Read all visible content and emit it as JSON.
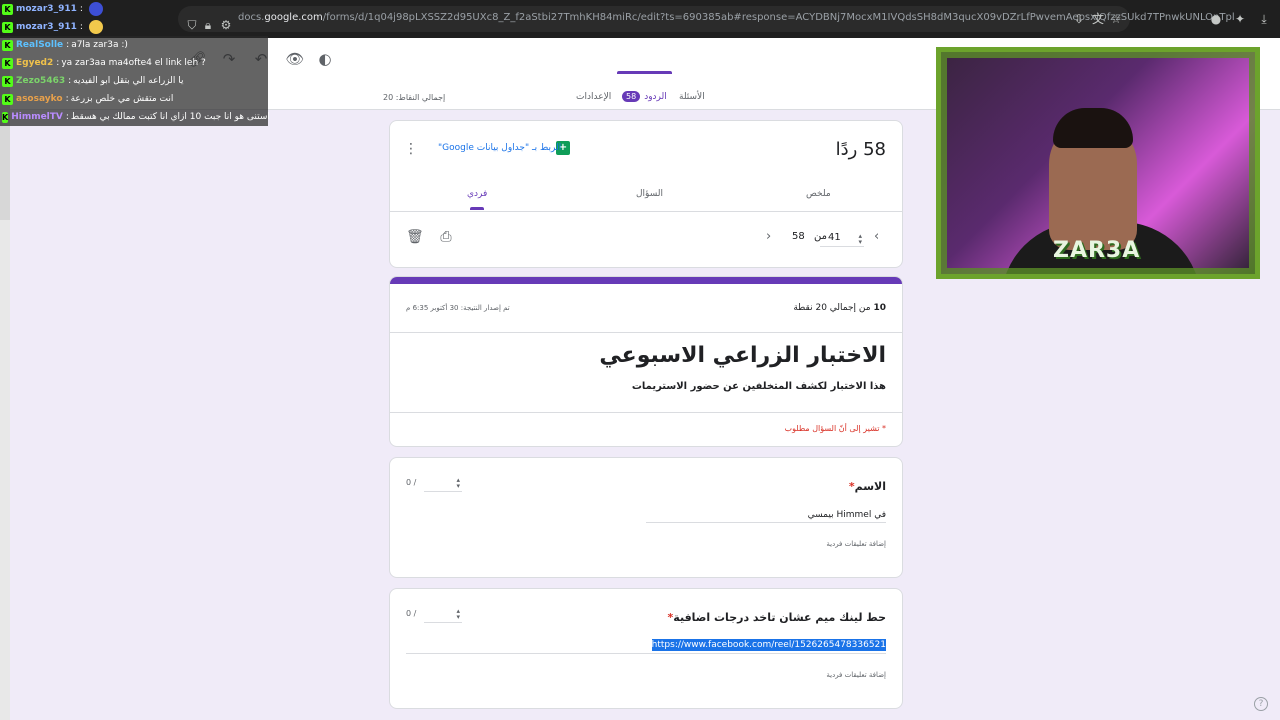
{
  "browser": {
    "url_prefix": "docs.",
    "url_domain": "google.com",
    "url_path": "/forms/d/1q04j98pLXSSZ2d95UXc8_Z_f2aStbi27TmhKH84miRc/edit?ts=690385ab#response=ACYDBNj7MocxM1IVQdsSH8dM3qucX09vDZrLfPwvemAepsxiQfzzSUkd7TPnwkUNLOnTpl"
  },
  "chat": [
    {
      "user": "mozar3_911",
      "msg": "",
      "color": "#8fb3ff"
    },
    {
      "user": "mozar3_911",
      "msg": "",
      "color": "#8fb3ff"
    },
    {
      "user": "RealSolle",
      "msg": "a7la zar3a :)",
      "color": "#5dc1ff"
    },
    {
      "user": "Egyed2",
      "msg": "ya zar3aa ma4ofte4 el link leh ?",
      "color": "#f0c24b"
    },
    {
      "user": "Zezo5463",
      "msg": "يا الزراعه الي بتقل ابو الفيديه",
      "color": "#7bd36a"
    },
    {
      "user": "asosayko",
      "msg": "انت متقش مي خلص بزرعة",
      "color": "#e8a14b"
    },
    {
      "user": "HimmelTV",
      "msg": "استنى هو انا جبت 10 ازاي انا كتبت ممالك بي هسقط",
      "color": "#b98cff"
    }
  ],
  "tabs": {
    "questions": "الأسئلة",
    "responses": "الردود",
    "responses_count": "58",
    "settings": "الإعدادات",
    "total_points": "إجمالي النقاط: 20"
  },
  "summary": {
    "count_text": "58 ردًا",
    "sheets_link": "الربط بـ \"جداول بيانات Google\"",
    "subtabs": {
      "summary": "ملخص",
      "question": "السؤال",
      "individual": "فردي"
    },
    "pager_current": "41",
    "pager_of": "من",
    "pager_total": "58"
  },
  "header": {
    "score_num": "10",
    "score_text": "من إجمالي 20 نقطة",
    "released": "تم إصدار النتيجة: 30 أكتوبر 6:35 م",
    "title": "الاختبار الزراعي الاسبوعي",
    "description": "هذا الاختبار لكشف المتخلفين عن حضور الاستريمات",
    "required_note": "* تشير إلى أنّ السؤال مطلوب"
  },
  "questions": [
    {
      "title": "الاسم",
      "answer": "في Himmel بيمسي",
      "points": "0",
      "points_sep": "/",
      "feedback": "إضافة تعليقات فردية"
    },
    {
      "title": "حط لينك ميم عشان تاخد درجات اضافية",
      "answer": "https://www.facebook.com/reel/1526265478336521",
      "points": "0",
      "points_sep": "/",
      "feedback": "إضافة تعليقات فردية"
    }
  ],
  "webcam": {
    "overlay_text": "ZAR3A"
  },
  "colors": {
    "accent": "#673ab7",
    "background": "#f0ebf8",
    "kick_green": "#53fc18",
    "link": "#1a73e8"
  }
}
